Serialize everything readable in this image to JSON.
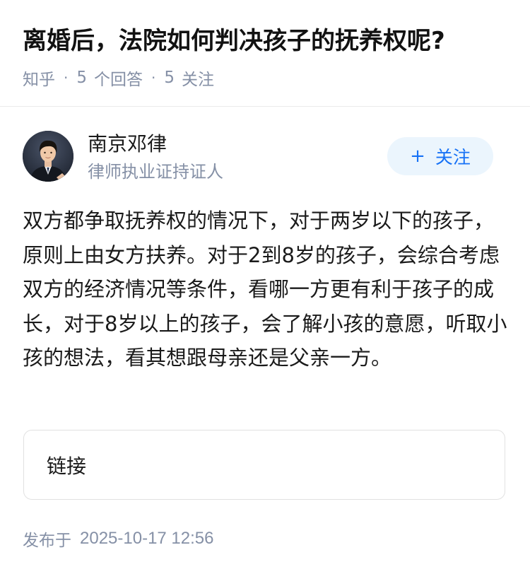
{
  "question": {
    "title": "离婚后，法院如何判决孩子的抚养权呢?",
    "source": "知乎",
    "answer_count": "5",
    "answer_label": "个回答",
    "follower_count": "5",
    "follower_label": "关注"
  },
  "author": {
    "name": "南京邓律",
    "badge": "律师执业证持证人",
    "follow_label": "关注",
    "avatar_icon": "person-portrait-avatar"
  },
  "answer": {
    "content": "双方都争取抚养权的情况下，对于两岁以下的孩子，原则上由女方扶养。对于2到8岁的孩子，会综合考虑双方的经济情况等条件，看哪一方更有利于孩子的成长，对于8岁以上的孩子，会了解小孩的意愿，听取小孩的想法，看其想跟母亲还是父亲一方。"
  },
  "link_card": {
    "label": "链接"
  },
  "publish": {
    "prefix": "发布于",
    "datetime": "2025-10-17 12:56"
  },
  "colors": {
    "accent": "#1772f6",
    "accent_bg": "#ebf5fd",
    "meta_text": "#8590a6",
    "body_text": "#1a1a1a"
  }
}
